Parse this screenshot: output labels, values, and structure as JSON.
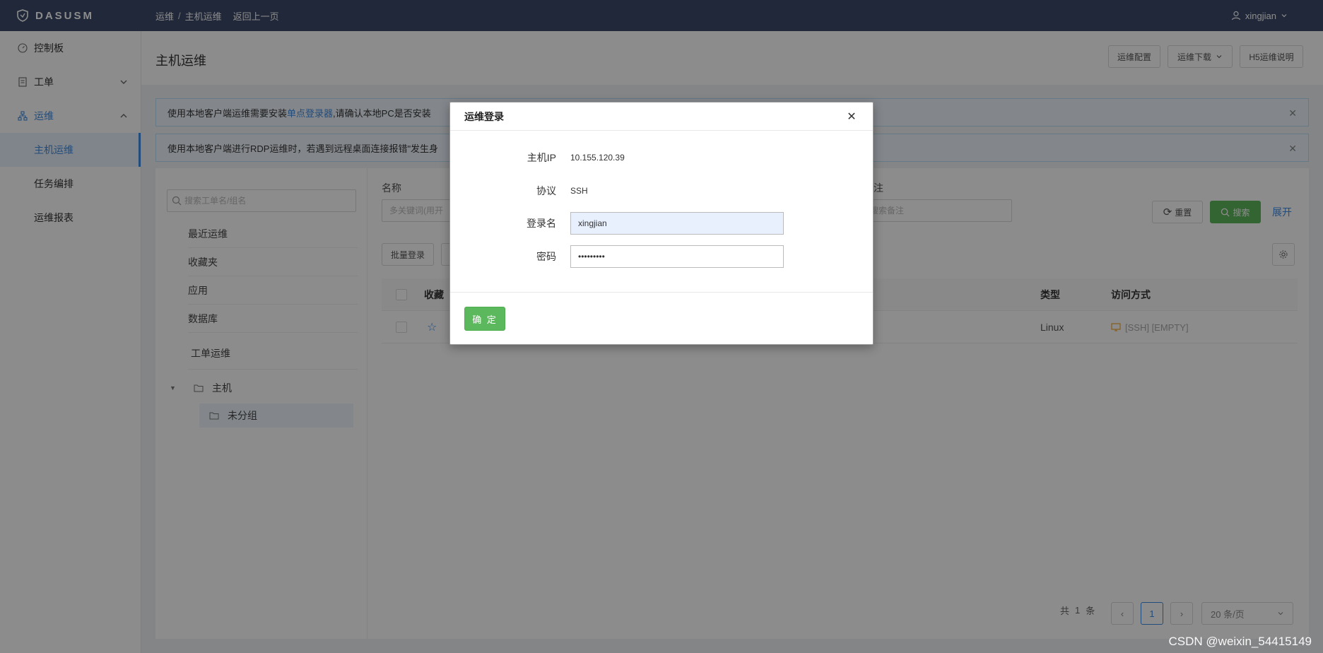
{
  "app": {
    "logo_text": "DASUSM"
  },
  "breadcrumb": {
    "root": "运维",
    "sep": "/",
    "current": "主机运维",
    "back": "返回上一页"
  },
  "user": {
    "name": "xingjian"
  },
  "sidebar": {
    "dashboard": "控制板",
    "workorder": "工单",
    "ops": "运维",
    "ops_items": [
      "主机运维",
      "任务编排",
      "运维报表"
    ]
  },
  "header": {
    "title": "主机运维",
    "buttons": {
      "config": "运维配置",
      "download": "运维下载",
      "h5_help": "H5运维说明"
    }
  },
  "alerts": {
    "a1_pre": "使用本地客户端运维需要安装",
    "a1_link": "单点登录器",
    "a1_post": ",请确认本地PC是否安装",
    "a2": "使用本地客户端进行RDP运维时，若遇到远程桌面连接报错\"发生身"
  },
  "tree": {
    "search_placeholder": "搜索工单名/组名",
    "items": [
      "最近运维",
      "收藏夹",
      "应用",
      "数据库",
      "工单运维"
    ],
    "host_node": "主机",
    "ungrouped": "未分组"
  },
  "filters": {
    "name_label": "名称",
    "name_placeholder": "多关键词(用开",
    "remark_label": "注",
    "remark_placeholder": "搜索备注",
    "reset": "重置",
    "search": "搜索",
    "expand": "展开",
    "batch_login": "批量登录"
  },
  "table": {
    "columns": {
      "fav": "收藏",
      "type": "类型",
      "access": "访问方式"
    },
    "rows": [
      {
        "type": "Linux",
        "access": "[SSH] [EMPTY]"
      }
    ]
  },
  "pagination": {
    "total_pre": "共",
    "total": "1",
    "total_post": "条",
    "page": "1",
    "page_size": "20 条/页"
  },
  "modal": {
    "title": "运维登录",
    "host_ip_label": "主机IP",
    "host_ip": "10.155.120.39",
    "protocol_label": "协议",
    "protocol": "SSH",
    "login_label": "登录名",
    "login_value": "xingjian",
    "password_label": "密码",
    "password_value": "•••••••••",
    "ok": "确 定"
  },
  "watermark": "CSDN @weixin_54415149",
  "colors": {
    "topbar": "#3c4a6b",
    "accent": "#3f8ae0",
    "ok_green": "#5cb85c"
  }
}
